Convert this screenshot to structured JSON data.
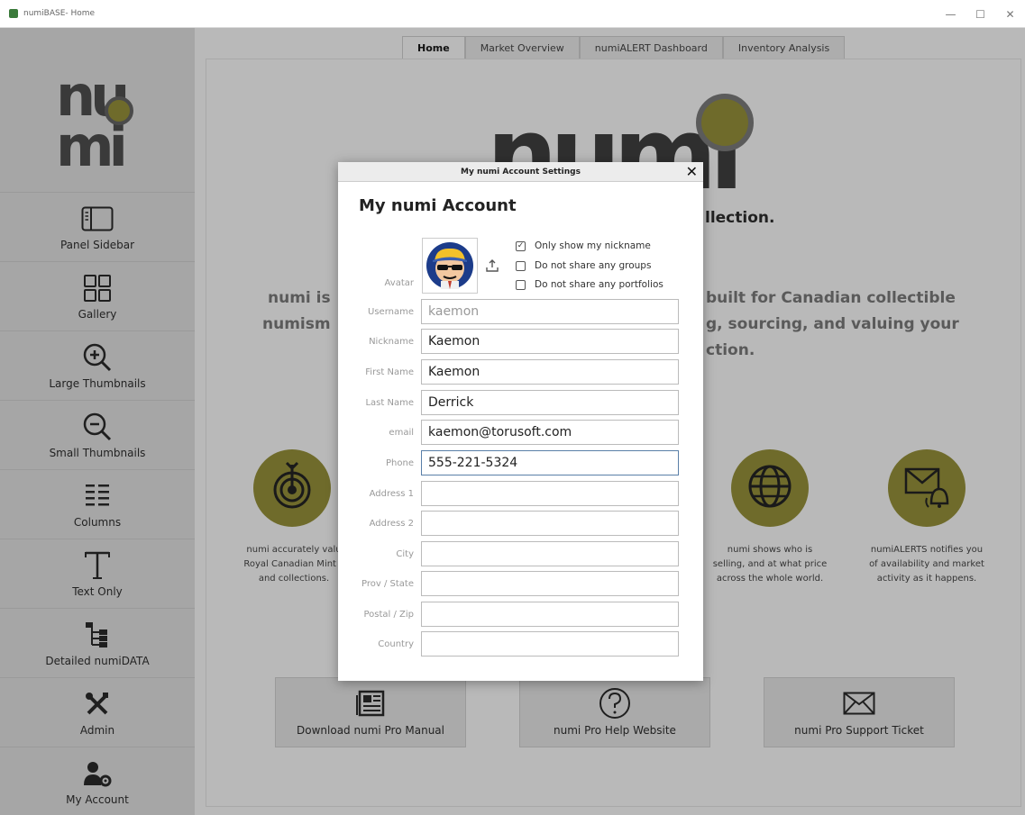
{
  "window": {
    "title": "numiBASE- Home",
    "minimize": "—",
    "maximize": "☐",
    "close": "✕"
  },
  "sidebar": {
    "logo_top": "nu",
    "logo_bottom": "mi",
    "items": [
      {
        "label": "Panel Sidebar",
        "icon": "panel-sidebar-icon"
      },
      {
        "label": "Gallery",
        "icon": "gallery-icon"
      },
      {
        "label": "Large Thumbnails",
        "icon": "zoom-in-icon"
      },
      {
        "label": "Small Thumbnails",
        "icon": "zoom-out-icon"
      },
      {
        "label": "Columns",
        "icon": "columns-icon"
      },
      {
        "label": "Text Only",
        "icon": "text-icon"
      },
      {
        "label": "Detailed numiDATA",
        "icon": "tree-icon"
      },
      {
        "label": "Admin",
        "icon": "tools-icon"
      },
      {
        "label": "My Account",
        "icon": "user-settings-icon"
      }
    ]
  },
  "tabs": [
    "Home",
    "Market Overview",
    "numiALERT Dashboard",
    "Inventory Analysis"
  ],
  "home": {
    "bg_logo": "numi",
    "tagline_fragment": "llection.",
    "intro_left_1": "numi is",
    "intro_left_2": "numism",
    "intro_right_1": "built for Canadian collectible",
    "intro_right_2": "g, sourcing, and valuing your",
    "intro_right_3": "ction.",
    "features": [
      {
        "icon": "target-icon",
        "text_1": "numi accurately valu",
        "text_2": "Royal Canadian Mint c",
        "text_3": "and collections."
      },
      {
        "icon": "globe-icon",
        "text_1": "numi shows who is",
        "text_2": "selling, and at what price",
        "text_3": "across the whole world."
      },
      {
        "icon": "alert-mail-icon",
        "text_1": "numiALERTS notifies you",
        "text_2": "of availability and market",
        "text_3": "activity as it happens."
      }
    ],
    "help_buttons": [
      {
        "label": "Download numi Pro Manual",
        "icon": "manual-icon"
      },
      {
        "label": "numi Pro Help Website",
        "icon": "help-icon"
      },
      {
        "label": "numi Pro Support Ticket",
        "icon": "mail-icon"
      }
    ]
  },
  "dialog": {
    "title": "My numi Account Settings",
    "close": "✕",
    "heading": "My numi Account",
    "avatar_label": "Avatar",
    "checkboxes": [
      {
        "label": "Only show my nickname",
        "checked": true
      },
      {
        "label": "Do not share any groups",
        "checked": false
      },
      {
        "label": "Do not share any portfolios",
        "checked": false
      }
    ],
    "fields": [
      {
        "label": "Username",
        "value": "kaemon"
      },
      {
        "label": "Nickname",
        "value": "Kaemon"
      },
      {
        "label": "First Name",
        "value": "Kaemon"
      },
      {
        "label": "Last Name",
        "value": "Derrick"
      },
      {
        "label": "email",
        "value": "kaemon@torusoft.com"
      },
      {
        "label": "Phone",
        "value": "555-221-5324"
      },
      {
        "label": "Address 1",
        "value": ""
      },
      {
        "label": "Address 2",
        "value": ""
      },
      {
        "label": "City",
        "value": ""
      },
      {
        "label": "Prov / State",
        "value": ""
      },
      {
        "label": "Postal / Zip",
        "value": ""
      },
      {
        "label": "Country",
        "value": ""
      }
    ]
  },
  "colors": {
    "accent_olive": "#6f6b2b",
    "sidebar": "#a6a6a6",
    "focus": "#5a7fa8"
  }
}
